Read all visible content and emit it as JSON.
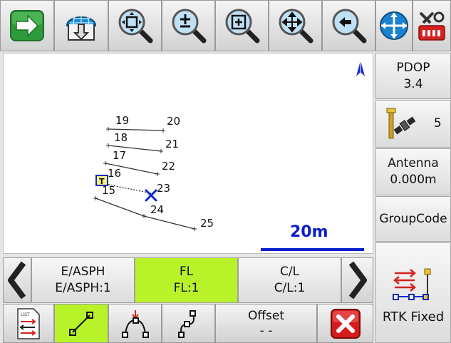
{
  "toolbar": {
    "buttons": [
      {
        "name": "next-arrow-icon"
      },
      {
        "name": "globe-download-icon"
      },
      {
        "name": "zoom-extents-icon"
      },
      {
        "name": "zoom-in-out-icon"
      },
      {
        "name": "zoom-window-icon"
      },
      {
        "name": "pan-icon"
      },
      {
        "name": "zoom-previous-icon"
      },
      {
        "name": "gnss-globe-icon"
      },
      {
        "name": "settings-tools-icon"
      }
    ]
  },
  "status": {
    "pdop_label": "PDOP",
    "pdop_value": "3.4",
    "satellites": "5",
    "antenna_label": "Antenna",
    "antenna_value": "0.000m",
    "group_code": "GroupCode",
    "rtk_status": "RTK Fixed"
  },
  "map": {
    "scale_label": "20m",
    "north_icon": "north-arrow-icon",
    "points": [
      {
        "label": "19"
      },
      {
        "label": "20"
      },
      {
        "label": "18"
      },
      {
        "label": "21"
      },
      {
        "label": "17"
      },
      {
        "label": "22"
      },
      {
        "label": "16"
      },
      {
        "label": "23"
      },
      {
        "label": "15"
      },
      {
        "label": "24"
      },
      {
        "label": "25"
      }
    ],
    "marker_label": "T",
    "colors": {
      "scale": "#0a1ecc",
      "marker_fill": "#f7f27a",
      "cross": "#1028c8",
      "background": "#ffffff"
    }
  },
  "codes": [
    {
      "line1": "E/ASPH",
      "line2": "E/ASPH:1",
      "active": false
    },
    {
      "line1": "FL",
      "line2": "FL:1",
      "active": true
    },
    {
      "line1": "C/L",
      "line2": "C/L:1",
      "active": false
    }
  ],
  "bottom": {
    "offset_label": "Offset",
    "offset_value": "- -"
  },
  "accent_green": "#b8f32a",
  "close_red": "#d41c1c"
}
